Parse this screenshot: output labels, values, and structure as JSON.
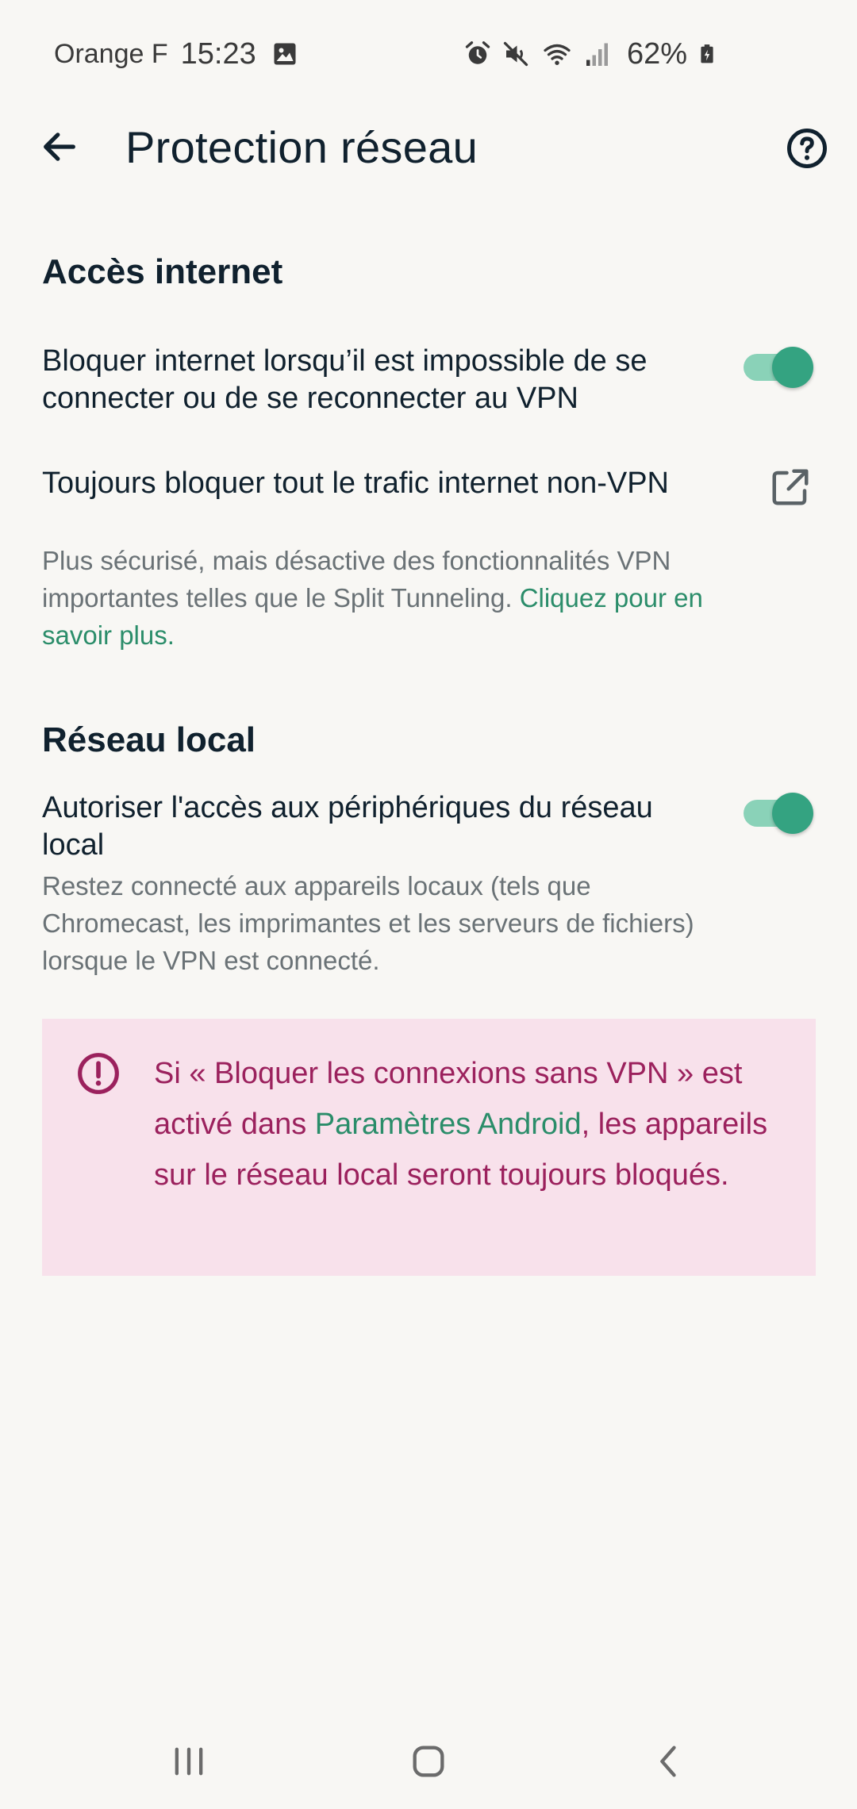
{
  "status_bar": {
    "carrier": "Orange F",
    "time": "15:23",
    "battery_percent": "62%",
    "icons": [
      "image-icon",
      "alarm-icon",
      "mute-icon",
      "wifi-icon",
      "signal-icon",
      "battery-icon"
    ]
  },
  "app_bar": {
    "title": "Protection réseau",
    "back_icon": "arrow-back-icon",
    "help_icon": "help-circle-icon"
  },
  "sections": {
    "internet": {
      "heading": "Accès internet",
      "kill_switch": {
        "title": "Bloquer internet lorsqu’il est impossible de se connecter ou de se reconnecter au VPN",
        "enabled": true
      },
      "always_block": {
        "title": "Toujours bloquer tout le trafic internet non-VPN",
        "description": "Plus sécurisé, mais désactive des fonctionnalités VPN importantes telles que le Split Tunneling. ",
        "learn_more": "Cliquez pour en savoir plus."
      }
    },
    "local_network": {
      "heading": "Réseau local",
      "lan_access": {
        "title": "Autoriser l'accès aux périphériques du réseau local",
        "description": "Restez connecté aux appareils locaux (tels que Chromecast, les imprimantes et les serveurs de fichiers) lorsque le VPN est connecté.",
        "enabled": true
      }
    }
  },
  "warning": {
    "text_before": "Si « Bloquer les connexions sans VPN » est activé dans ",
    "link": "Paramètres Android",
    "text_after": ", les appareils sur le réseau local seront toujours bloqués."
  },
  "colors": {
    "background": "#f8f7f4",
    "accent": "#34a381",
    "warning_bg": "#f8e1eb",
    "warning_text": "#9b215d"
  }
}
